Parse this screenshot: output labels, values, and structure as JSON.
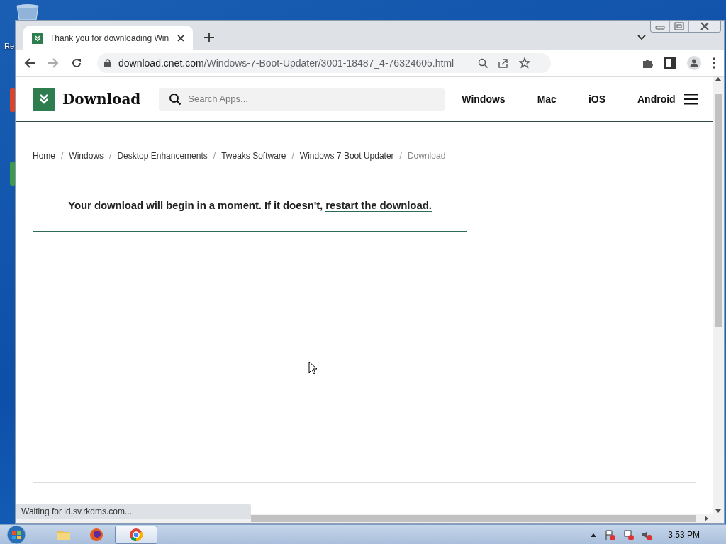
{
  "desktop": {
    "icon_label": "Re"
  },
  "browser": {
    "tabs": [
      {
        "title": "Thank you for downloading Win",
        "selected": true
      }
    ],
    "address": {
      "domain": "download.cnet.com",
      "path": "/Windows-7-Boot-Updater/3001-18487_4-76324605.html"
    },
    "status": "Waiting for id.sv.rkdms.com..."
  },
  "site": {
    "logo": "Download",
    "search": {
      "placeholder": "Search Apps..."
    },
    "nav": [
      "Windows",
      "Mac",
      "iOS",
      "Android"
    ],
    "breadcrumb": {
      "separator": "/",
      "items": [
        {
          "label": "Home",
          "current": false
        },
        {
          "label": "Windows",
          "current": false
        },
        {
          "label": "Desktop Enhancements",
          "current": false
        },
        {
          "label": "Tweaks Software",
          "current": false
        },
        {
          "label": "Windows 7 Boot Updater",
          "current": false
        },
        {
          "label": "Download",
          "current": true
        }
      ]
    },
    "message": {
      "text": "Your download will begin in a moment. If it doesn't,",
      "link": "restart the download."
    }
  },
  "taskbar": {
    "apps": [
      {
        "kind": "folder",
        "selected": false
      },
      {
        "kind": "firefox",
        "selected": false
      },
      {
        "kind": "chrome",
        "selected": true
      }
    ],
    "clock": "3:53 PM"
  }
}
